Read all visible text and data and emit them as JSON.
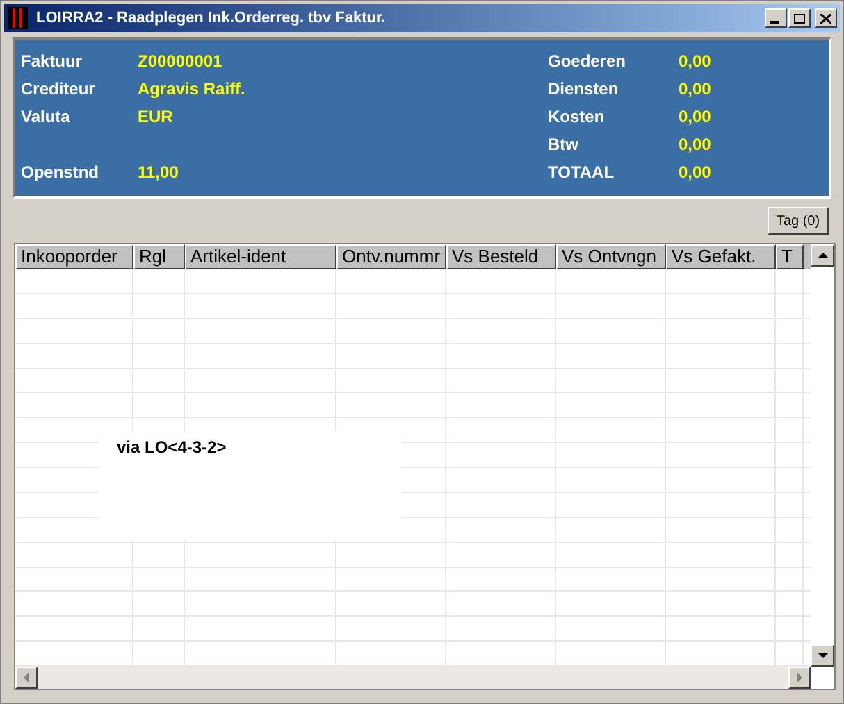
{
  "window": {
    "title": "LOIRRA2 - Raadplegen Ink.Orderreg. tbv Faktur."
  },
  "header_left": [
    {
      "label": "Faktuur",
      "value": "Z00000001"
    },
    {
      "label": "Crediteur",
      "value": "Agravis Raiff."
    },
    {
      "label": "Valuta",
      "value": "EUR"
    },
    {
      "label": "Openstnd",
      "value": "11,00"
    }
  ],
  "header_right": [
    {
      "label": "Goederen",
      "value": "0,00"
    },
    {
      "label": "Diensten",
      "value": "0,00"
    },
    {
      "label": "Kosten",
      "value": "0,00"
    },
    {
      "label": "Btw",
      "value": "0,00"
    },
    {
      "label": "TOTAAL",
      "value": "0,00"
    }
  ],
  "tag_button": "Tag (0)",
  "table": {
    "columns": [
      "Inkooporder",
      "Rgl",
      "Artikel-ident",
      "Ontv.nummr",
      "Vs Besteld",
      "Vs Ontvngn",
      "Vs Gefakt.",
      "T"
    ]
  },
  "overlay": {
    "text": "via LO<4-3-2>"
  }
}
